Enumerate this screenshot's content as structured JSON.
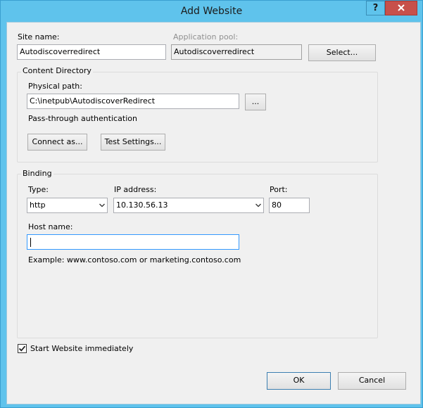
{
  "window": {
    "title": "Add Website",
    "help_label": "?"
  },
  "site": {
    "label": "Site name:",
    "value": "Autodiscoverredirect"
  },
  "app_pool": {
    "label": "Application pool:",
    "value": "Autodiscoverredirect",
    "select_label": "Select..."
  },
  "content": {
    "legend": "Content Directory",
    "physical_path_label": "Physical path:",
    "physical_path_value": "C:\\inetpub\\AutodiscoverRedirect",
    "browse_label": "...",
    "passthrough_label": "Pass-through authentication",
    "connect_label": "Connect as...",
    "test_label": "Test Settings..."
  },
  "binding": {
    "legend": "Binding",
    "type_label": "Type:",
    "type_value": "http",
    "ip_label": "IP address:",
    "ip_value": "10.130.56.13",
    "port_label": "Port:",
    "port_value": "80",
    "host_label": "Host name:",
    "host_value": "",
    "example_text": "Example: www.contoso.com or marketing.contoso.com"
  },
  "start": {
    "label": "Start Website immediately",
    "checked": true
  },
  "footer": {
    "ok_label": "OK",
    "cancel_label": "Cancel"
  },
  "colors": {
    "titlebar": "#5fc3ec",
    "close": "#c7504a",
    "client": "#f0f0f0"
  }
}
